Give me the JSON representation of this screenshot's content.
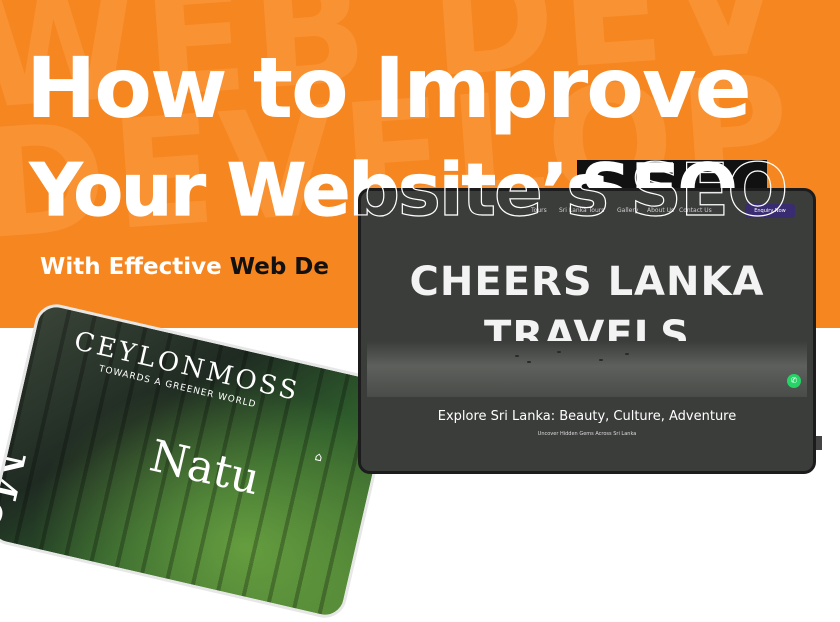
{
  "banner": {
    "background_color": "#f6861f",
    "headline_line1": "How to Improve",
    "headline_line2_main": "Your Website’s ",
    "headline_seo": "SEO",
    "subhead_lead": "With Effective ",
    "subhead_dark": "Web De"
  },
  "ceylon_moss": {
    "logo": "CEYLONMOSS",
    "tagline": "TOWARDS A GREENER WORLD",
    "vertical_text": "Moss",
    "headline": "Natu"
  },
  "cheers_lanka": {
    "nav_links": [
      "Tours",
      "Sri Lanka Tours",
      "Gallery",
      "About Us",
      "Contact Us"
    ],
    "enquiry_button": "Enquiry Now",
    "hero_title_line1": "CHEERS LANKA",
    "hero_title_line2": "TRAVELS",
    "explore_heading": "Explore Sri Lanka: Beauty, Culture, Adventure",
    "explore_sub": "Uncover Hidden Gems Across Sri Lanka"
  },
  "icons": [
    "whatsapp-icon",
    "home-icon",
    "bird-icon"
  ]
}
